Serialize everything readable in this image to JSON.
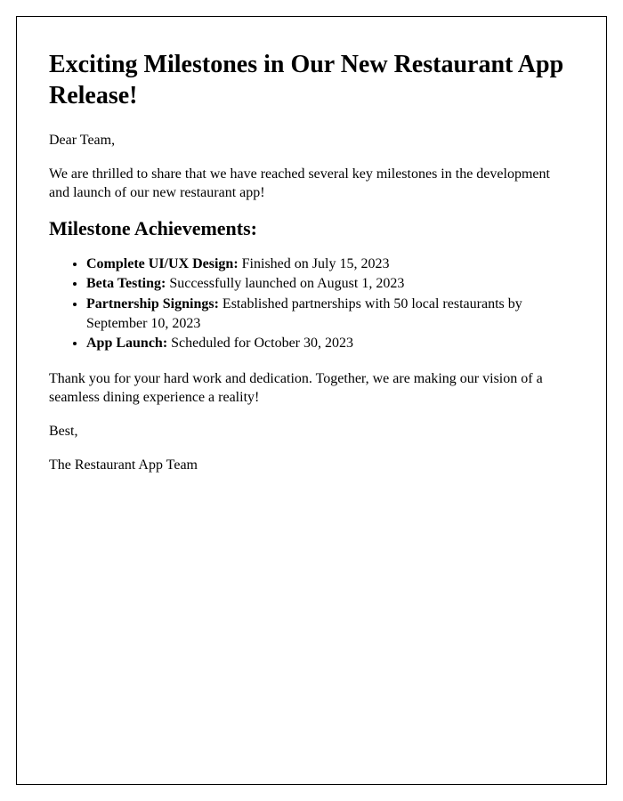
{
  "title": "Exciting Milestones in Our New Restaurant App Release!",
  "greeting": "Dear Team,",
  "intro": "We are thrilled to share that we have reached several key milestones in the development and launch of our new restaurant app!",
  "section_heading": "Milestone Achievements:",
  "milestones": [
    {
      "label": "Complete UI/UX Design:",
      "text": " Finished on July 15, 2023"
    },
    {
      "label": "Beta Testing:",
      "text": " Successfully launched on August 1, 2023"
    },
    {
      "label": "Partnership Signings:",
      "text": " Established partnerships with 50 local restaurants by September 10, 2023"
    },
    {
      "label": "App Launch:",
      "text": " Scheduled for October 30, 2023"
    }
  ],
  "thanks": "Thank you for your hard work and dedication. Together, we are making our vision of a seamless dining experience a reality!",
  "signoff": "Best,",
  "signature": "The Restaurant App Team"
}
